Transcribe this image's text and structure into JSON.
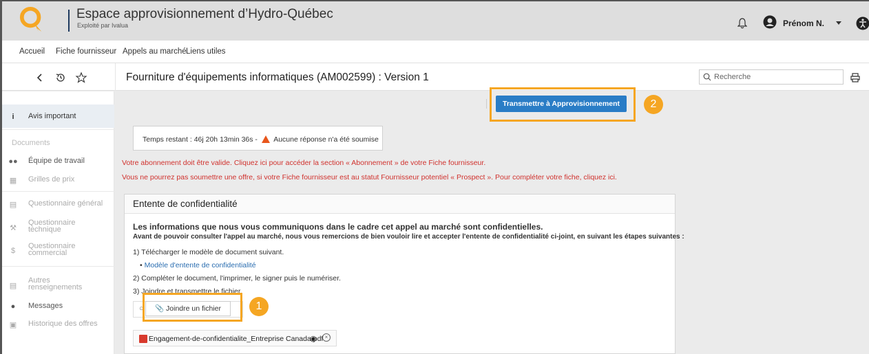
{
  "header": {
    "title": "Espace approvisionnement d’Hydro-Québec",
    "subtitle": "Exploité par Ivalua",
    "user_name": "Prénom N."
  },
  "menu": [
    "Accueil",
    "Fiche fournisseur",
    "Appels au marché",
    "Liens utiles"
  ],
  "toolbar": {
    "page_title": "Fourniture d'équipements informatiques (AM002599) : Version 1",
    "search_placeholder": "Recherche"
  },
  "sidebar": {
    "active": "Avis important",
    "section_documents": "Documents",
    "items": [
      {
        "label": "Équipe de travail",
        "enabled": true
      },
      {
        "label": "Grilles de prix",
        "enabled": false
      },
      {
        "label": "Questionnaire général",
        "enabled": false
      },
      {
        "label": "Questionnaire technique",
        "enabled": false
      },
      {
        "label": "Questionnaire commercial",
        "enabled": false
      },
      {
        "label": "Autres renseignements",
        "enabled": false
      },
      {
        "label": "Messages",
        "enabled": true
      },
      {
        "label": "Historique des offres",
        "enabled": false
      }
    ]
  },
  "actions": {
    "transmit_label": "Transmettre à Approvisionnement",
    "attach_label": "Joindre un fichier"
  },
  "badges": [
    "2",
    "1"
  ],
  "time": {
    "prefix": "Temps restant :",
    "value": "46j 20h 13min 36s -",
    "warning": "Aucune réponse n'a été soumise"
  },
  "alerts": [
    "Votre abonnement doit être valide. Cliquez ici pour accéder la section « Abonnement » de votre Fiche fournisseur.",
    "Vous ne pourrez pas soumettre une offre, si votre Fiche fournisseur est au statut Fournisseur potentiel « Prospect ». Pour compléter votre fiche, cliquez ici."
  ],
  "panel": {
    "title": "Entente de confidentialité",
    "lead": "Les informations que nous vous communiquons dans le cadre cet appel au marché sont confidentielles.",
    "intro": "Avant de pouvoir consulter l'appel au marché, nous vous remercions de bien vouloir lire et accepter l'entente de confidentialité ci-joint, en suivant les étapes suivantes :",
    "step1": "1) Télécharger le modèle de document suivant.",
    "link": "Modèle d'entente de confidentialité",
    "step2": "2) Compléter le document, l'imprimer, le signer puis le numériser.",
    "step3": "3) Joindre et transmettre le fichier.",
    "file_name": "Engagement-de-confidentialite_Entreprise Canada.pdf"
  },
  "colors": {
    "accent": "#2a7dc6",
    "highlight": "#f5a623",
    "alert": "#d0312d"
  }
}
